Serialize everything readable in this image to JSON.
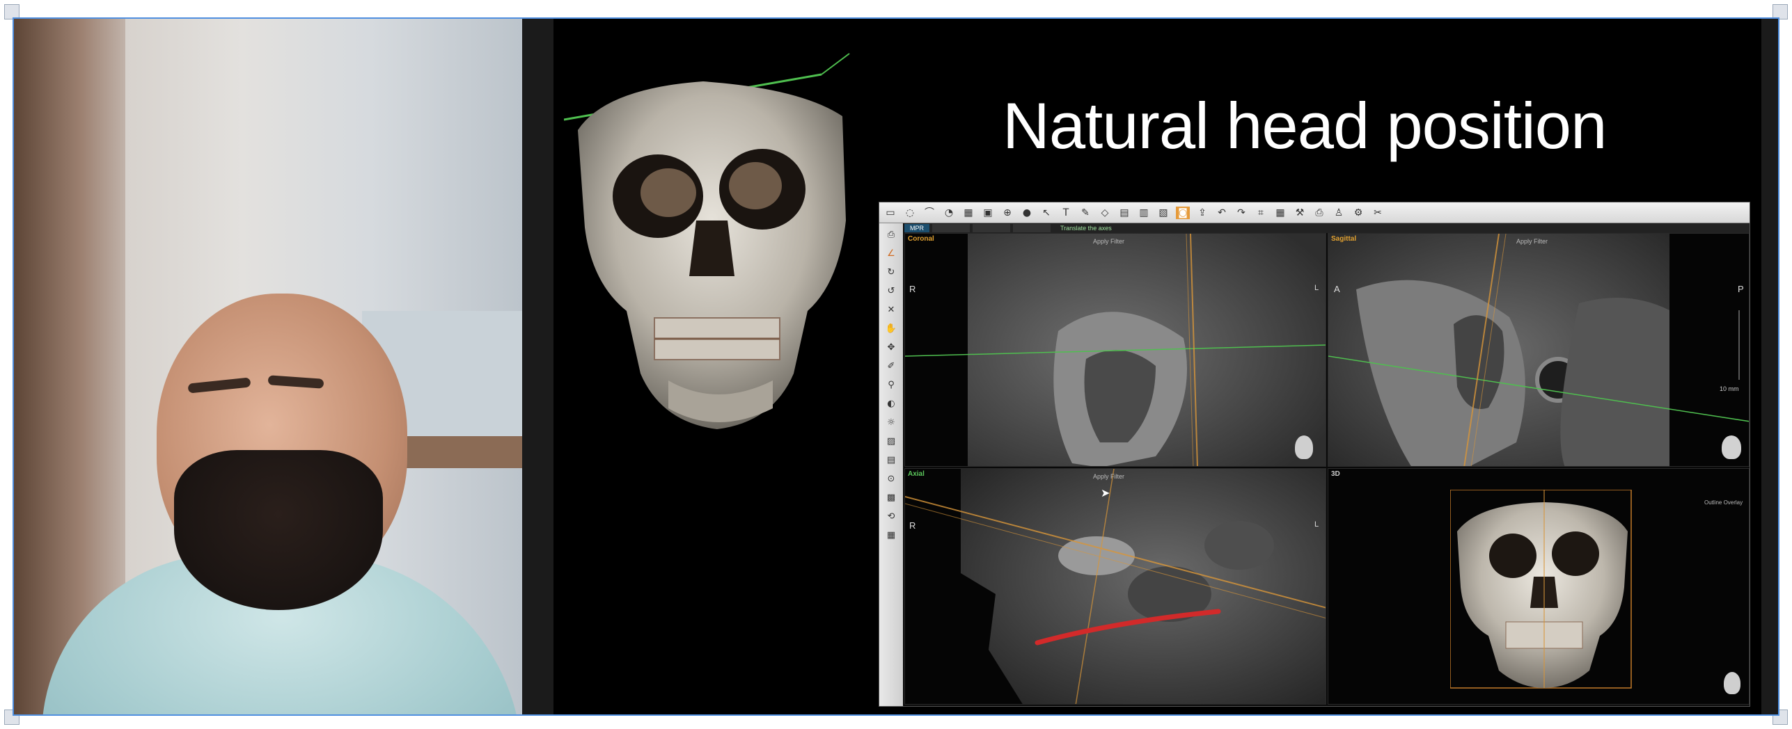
{
  "slide": {
    "title": "Natural head position"
  },
  "viewer": {
    "tabs": [
      {
        "label": "MPR",
        "active": true
      },
      {
        "label": "",
        "active": false
      },
      {
        "label": "",
        "active": false
      },
      {
        "label": "",
        "active": false
      }
    ],
    "tab_hint": "Translate the axes",
    "panes": {
      "coronal": {
        "label": "Coronal",
        "label_color": "#e0a030",
        "left_marker": "R",
        "right_marker": "L",
        "caption": "Apply Filter"
      },
      "sagittal": {
        "label": "Sagittal",
        "label_color": "#e0a030",
        "left_marker": "A",
        "right_marker": "P",
        "caption": "Apply Filter",
        "scale": "10 mm"
      },
      "axial": {
        "label": "Axial",
        "label_color": "#5cc85c",
        "left_marker": "R",
        "right_marker": "L",
        "caption": "Apply Filter"
      },
      "three_d": {
        "label": "3D",
        "label_color": "#cccccc",
        "overlay": "Outline Overlay"
      }
    },
    "colors": {
      "coronal_accent": "#e0a030",
      "axial_accent": "#5cc85c",
      "annotation_red": "#d22a2a"
    }
  },
  "icons": {
    "toolbar": [
      "ruler-icon",
      "lasso-icon",
      "curve-icon",
      "measure-icon",
      "graph-icon",
      "grid-icon",
      "globe-icon",
      "color-icon",
      "pointer-icon",
      "text-icon",
      "pencil-icon",
      "shape-icon",
      "report-icon",
      "layout-icon",
      "image-icon",
      "camera-icon",
      "export-icon",
      "undo-icon",
      "redo-icon",
      "mesh-icon",
      "table-icon",
      "tool-icon",
      "print-icon",
      "person-icon",
      "settings-icon",
      "wrench-icon"
    ],
    "sidebar": [
      "print-icon",
      "angle-icon",
      "rotate-icon",
      "rotate-ccw-icon",
      "close-icon",
      "hand-icon",
      "move-icon",
      "brush-icon",
      "zoom-icon",
      "contrast-icon",
      "brightness-icon",
      "gradient-icon",
      "slice-icon",
      "magnify-icon",
      "filter-icon",
      "reset-icon",
      "grid-icon"
    ]
  }
}
